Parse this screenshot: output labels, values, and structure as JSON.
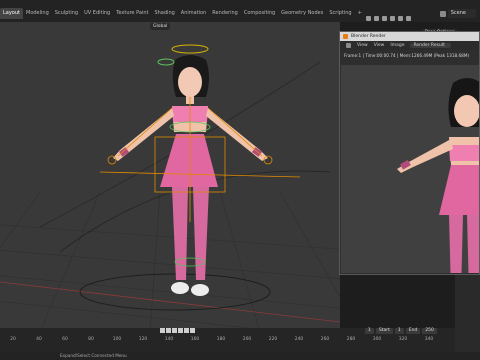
{
  "workspace_tabs": [
    "Layout",
    "Modeling",
    "Sculpting",
    "UV Editing",
    "Texture Paint",
    "Shading",
    "Animation",
    "Rendering",
    "Compositing",
    "Geometry Nodes",
    "Scripting",
    "+"
  ],
  "scene": {
    "label": "Scene"
  },
  "viewport_header": {
    "transform_orientation": "Global",
    "pose_options": "Pose Options"
  },
  "render_window": {
    "title": "Blender Render",
    "menu": [
      "View",
      "View",
      "Image"
    ],
    "image_name": "Render Result",
    "info": "Frame:1 | Time:00:00.74 | Mem:1266.49M (Peak 1318.68M)"
  },
  "timeline": {
    "frame_current": "1",
    "start_label": "Start",
    "start_value": "1",
    "end_label": "End",
    "end_value": "250",
    "ruler": [
      "20",
      "40",
      "60",
      "80",
      "100",
      "120",
      "140",
      "160",
      "180",
      "200",
      "220",
      "240",
      "260",
      "280",
      "300",
      "320",
      "340"
    ]
  },
  "status": {
    "text": "Expand/Select Connected Menu"
  },
  "colors": {
    "dress": "#e0679f",
    "stripe_pink": "#ee7fb0",
    "stocking": "#d66a9e",
    "rig_orange": "#e28a00",
    "rig_green": "#5cc25c",
    "viewport_bg": "#393939"
  }
}
